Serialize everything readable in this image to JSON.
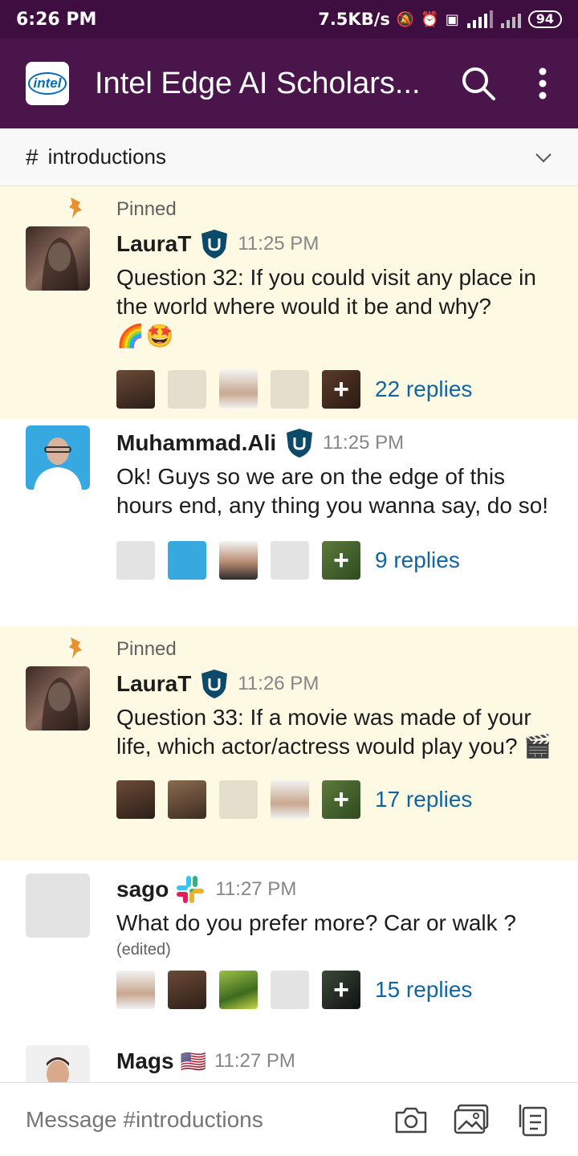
{
  "status_bar": {
    "time": "6:26 PM",
    "net_speed": "7.5KB/s",
    "battery": "94"
  },
  "app_bar": {
    "workspace_logo_text": "intel",
    "workspace_title": "Intel Edge AI Scholars...",
    "icons": [
      "search-icon",
      "more-vertical-icon"
    ],
    "colors": {
      "background": "#4a154b",
      "status_bar": "#3f0e40"
    }
  },
  "channel": {
    "hash": "#",
    "name": "introductions"
  },
  "messages": [
    {
      "pinned_label": "Pinned",
      "author": "LauraT",
      "time": "11:25 PM",
      "text": "Question 32: If you could visit any place in the world where would it be and why?",
      "emoji": [
        "🌈",
        "🤩"
      ],
      "replies": "22 replies"
    },
    {
      "author": "Muhammad.Ali",
      "time": "11:25 PM",
      "text": "Ok! Guys so we are on the edge of this hours end, any thing you wanna say, do so!",
      "replies": "9 replies"
    },
    {
      "pinned_label": "Pinned",
      "author": "LauraT",
      "time": "11:26 PM",
      "text": "Question 33: If a movie was made of your life, which actor/actress would play you?",
      "emoji": [
        "🎬"
      ],
      "replies": "17 replies"
    },
    {
      "author": "sago",
      "time": "11:27 PM",
      "text": "What do you prefer more? Car or walk ?",
      "edited": "(edited)",
      "replies": "15 replies"
    },
    {
      "author": "Mags",
      "flag": "🇺🇸",
      "time": "11:27 PM"
    }
  ],
  "composer": {
    "placeholder": "Message #introductions",
    "icons": [
      "camera-icon",
      "image-icon",
      "files-icon"
    ]
  }
}
